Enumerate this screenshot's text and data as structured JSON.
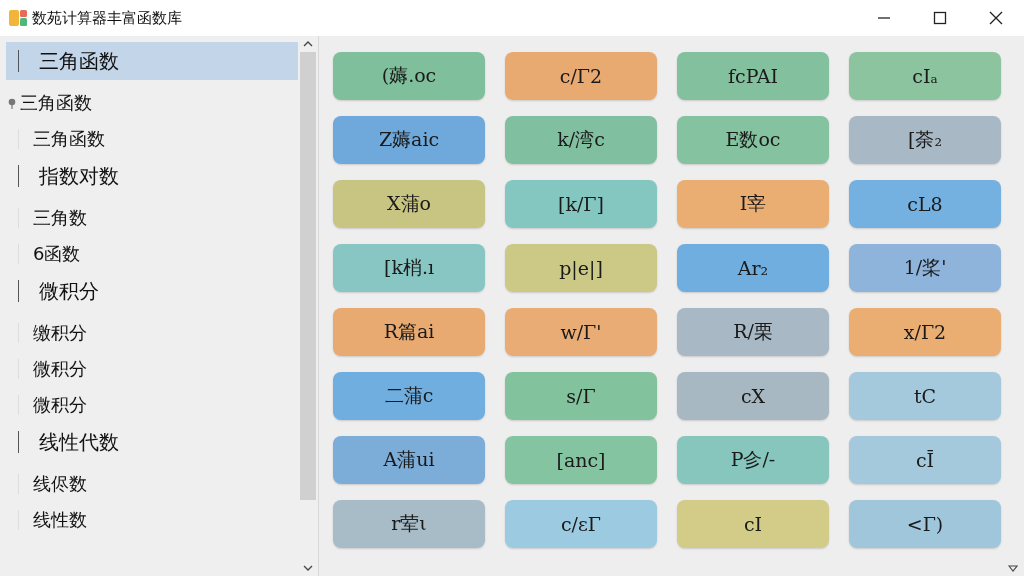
{
  "window": {
    "title": "数苑计算器丰富函数库"
  },
  "sidebar": {
    "items": [
      {
        "label": "三角函数",
        "selected": true,
        "children": [
          {
            "label": "三角函数",
            "kind": "pin",
            "selected": false
          },
          {
            "label": "三角函数",
            "kind": "plain",
            "selected": false
          }
        ]
      },
      {
        "label": "指数对数",
        "selected": false,
        "children": [
          {
            "label": "三角数",
            "kind": "plain",
            "selected": false
          },
          {
            "label": "6函数",
            "kind": "plain",
            "selected": false
          }
        ]
      },
      {
        "label": "微积分",
        "selected": false,
        "children": [
          {
            "label": "缴积分",
            "kind": "plain",
            "selected": false
          },
          {
            "label": "微积分",
            "kind": "plain",
            "selected": false
          },
          {
            "label": "微积分",
            "kind": "plain",
            "selected": false
          }
        ]
      },
      {
        "label": "线性代数",
        "selected": false,
        "children": [
          {
            "label": "线侭数",
            "kind": "plain",
            "selected": false
          },
          {
            "label": "线性数",
            "kind": "plain",
            "selected": false
          }
        ]
      }
    ]
  },
  "functions": [
    {
      "label": "(薅.oc",
      "color": "#80bf9c"
    },
    {
      "label": "c/Γ2",
      "color": "#e8aa70"
    },
    {
      "label": "fcPAI",
      "color": "#82c09e"
    },
    {
      "label": "cIₐ",
      "color": "#8cc4a0"
    },
    {
      "label": "Z薅aic",
      "color": "#6fa9dc"
    },
    {
      "label": "k/湾c",
      "color": "#80c0a0"
    },
    {
      "label": "E数oc",
      "color": "#84c2a0"
    },
    {
      "label": "[荼₂",
      "color": "#a8b8c4"
    },
    {
      "label": "X蒲o",
      "color": "#c8c482"
    },
    {
      "label": "[k/Γ]",
      "color": "#84c6c0"
    },
    {
      "label": "I宰",
      "color": "#eaae72"
    },
    {
      "label": "cL8",
      "color": "#74b0e0"
    },
    {
      "label": "[k梢.ı",
      "color": "#88c6c4"
    },
    {
      "label": "p|e|]",
      "color": "#ccc886"
    },
    {
      "label": "Ar₂",
      "color": "#70aee0"
    },
    {
      "label": "1/桨'",
      "color": "#8eb4dc"
    },
    {
      "label": "R篇ai",
      "color": "#e8aa70"
    },
    {
      "label": "w/Γ'",
      "color": "#e8ac74"
    },
    {
      "label": "R/栗",
      "color": "#a8b8c4"
    },
    {
      "label": "x/Γ2",
      "color": "#eaae72"
    },
    {
      "label": "二蒲c",
      "color": "#70aee0"
    },
    {
      "label": "s/Γ",
      "color": "#82c29c"
    },
    {
      "label": "cX",
      "color": "#a8b8c2"
    },
    {
      "label": "tC",
      "color": "#a4c8dc"
    },
    {
      "label": "A蒲ui",
      "color": "#7cacd8"
    },
    {
      "label": "[anc]",
      "color": "#84c4a0"
    },
    {
      "label": "P㐱/-",
      "color": "#86c6bc"
    },
    {
      "label": "cĪ",
      "color": "#a4c8dc"
    },
    {
      "label": "r荤ι",
      "color": "#a8bcc8"
    },
    {
      "label": "c/εΓ",
      "color": "#9ccae0"
    },
    {
      "label": "cI",
      "color": "#d2cc88"
    },
    {
      "label": "<Γ)",
      "color": "#a0c6dc"
    }
  ]
}
